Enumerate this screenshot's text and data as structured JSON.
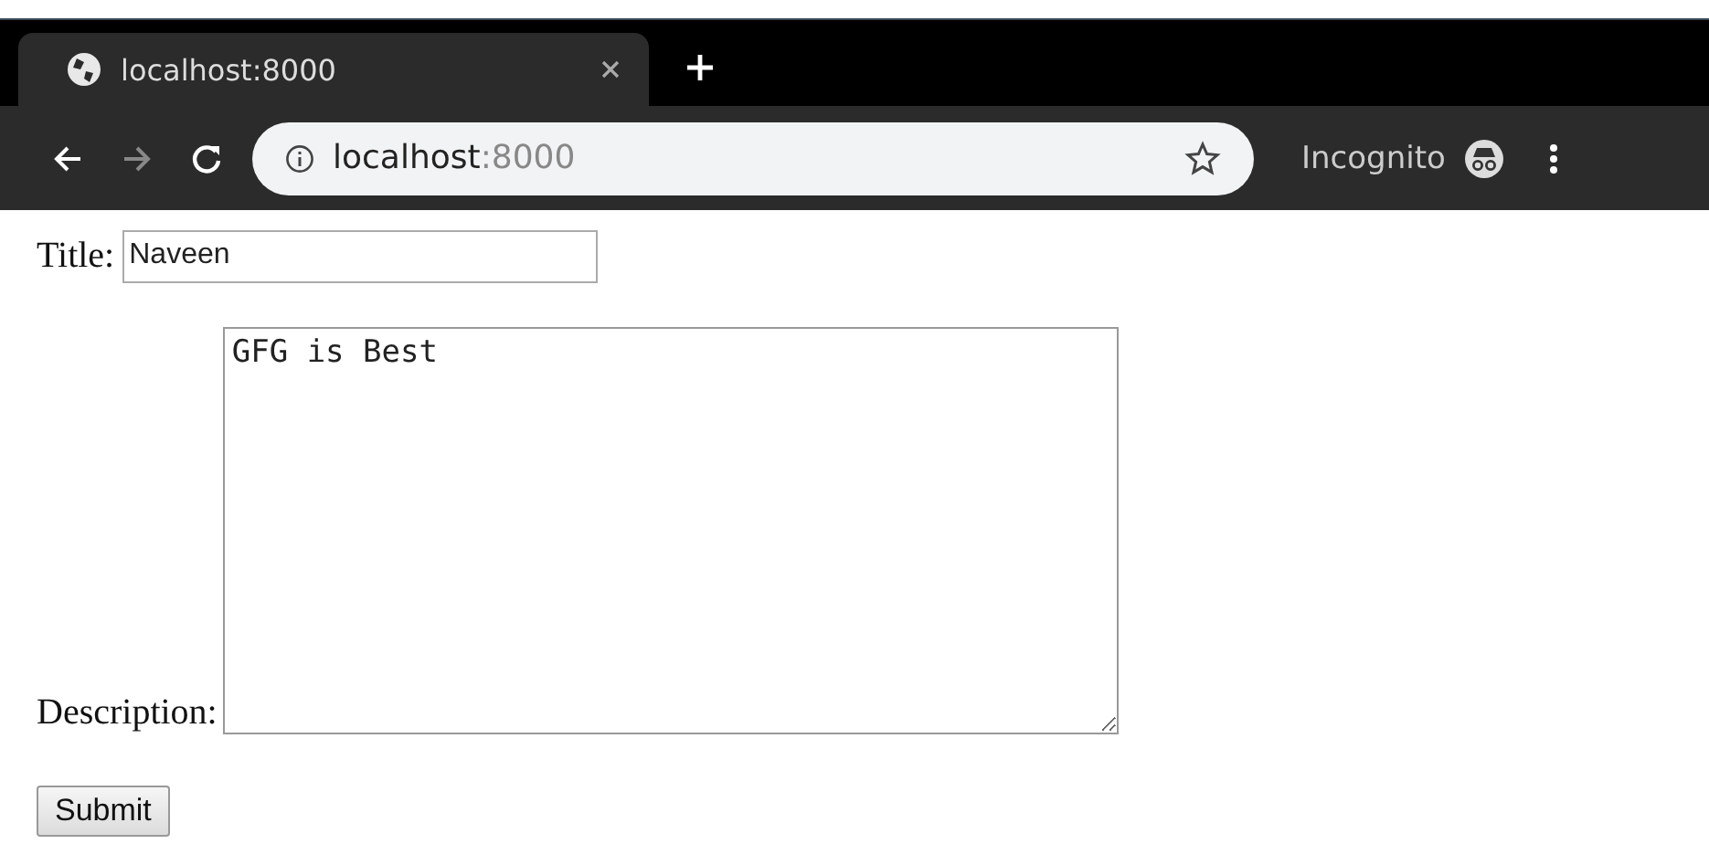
{
  "browser": {
    "tab": {
      "title": "localhost:8000"
    },
    "address": {
      "host": "localhost",
      "port": ":8000"
    },
    "profile": "Incognito"
  },
  "form": {
    "title_label": "Title:",
    "title_value": "Naveen",
    "description_label": "Description:",
    "description_value": "GFG is Best",
    "submit": "Submit"
  }
}
